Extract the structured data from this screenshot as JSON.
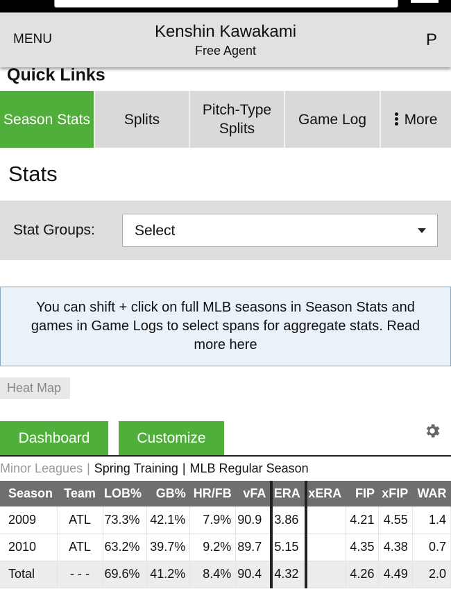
{
  "header": {
    "menu_label": "MENU",
    "player_name": "Kenshin Kawakami",
    "player_status": "Free Agent",
    "right_label": "P"
  },
  "quick_links": {
    "title": "Quick Links",
    "tabs": [
      {
        "label": "Season Stats",
        "active": true
      },
      {
        "label": "Splits",
        "active": false
      },
      {
        "label": "Pitch-Type Splits",
        "active": false
      },
      {
        "label": "Game Log",
        "active": false
      },
      {
        "label": "More",
        "active": false
      }
    ]
  },
  "stats": {
    "title": "Stats",
    "stat_groups_label": "Stat Groups:",
    "stat_groups_value": "Select"
  },
  "notice": "You can shift + click on full MLB seasons in Season Stats and games in Game Logs to select spans for aggregate stats. Read more here",
  "heat_map_label": "Heat Map",
  "buttons": {
    "dashboard": "Dashboard",
    "customize": "Customize"
  },
  "leagues": {
    "minor": "Minor Leagues",
    "spring": "Spring Training",
    "regular": "MLB Regular Season",
    "separator": "|"
  },
  "table": {
    "columns": [
      "Season",
      "Team",
      "LOB%",
      "GB%",
      "HR/FB",
      "vFA",
      "ERA",
      "xERA",
      "FIP",
      "xFIP",
      "WAR"
    ],
    "rows": [
      [
        "2009",
        "ATL",
        "73.3%",
        "42.1%",
        "7.9%",
        "90.9",
        "3.86",
        "",
        "4.21",
        "4.55",
        "1.4"
      ],
      [
        "2010",
        "ATL",
        "63.2%",
        "39.7%",
        "9.2%",
        "89.7",
        "5.15",
        "",
        "4.35",
        "4.38",
        "0.7"
      ],
      [
        "Total",
        "- - -",
        "69.6%",
        "41.2%",
        "8.4%",
        "90.4",
        "4.32",
        "",
        "4.26",
        "4.49",
        "2.0"
      ]
    ]
  },
  "colors": {
    "accent_green": "#50ae3a",
    "header_bg": "#e1e1e1",
    "table_header_bg": "#6f6f6f",
    "notice_bg": "#eaf2f9"
  }
}
